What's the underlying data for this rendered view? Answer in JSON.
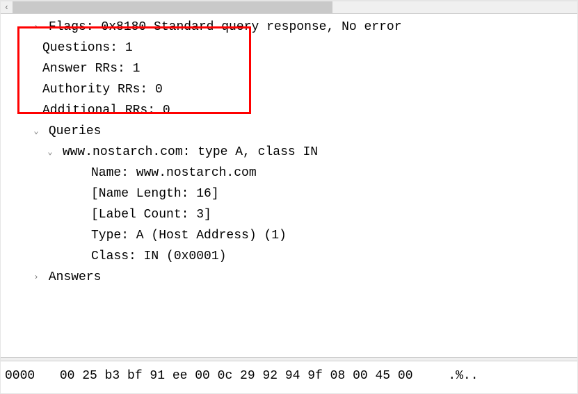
{
  "dns": {
    "flags_line": "Flags: 0x8180 Standard query response, No error",
    "questions": "Questions: 1",
    "answer_rrs": "Answer RRs: 1",
    "authority_rrs": "Authority RRs: 0",
    "additional_rrs": "Additional RRs: 0",
    "queries_label": "Queries",
    "query": {
      "summary": "www.nostarch.com: type A, class IN",
      "name": "Name: www.nostarch.com",
      "name_length": "[Name Length: 16]",
      "label_count": "[Label Count: 3]",
      "type": "Type: A (Host Address) (1)",
      "class": "Class: IN (0x0001)"
    },
    "answers_label": "Answers"
  },
  "hex": {
    "offset": "0000",
    "bytes": "00 25 b3 bf 91 ee 00 0c  29 92 94 9f 08 00 45 00",
    "ascii": ".%.."
  },
  "icons": {
    "right": "›",
    "down": "⌄",
    "left_arrow": "‹"
  }
}
